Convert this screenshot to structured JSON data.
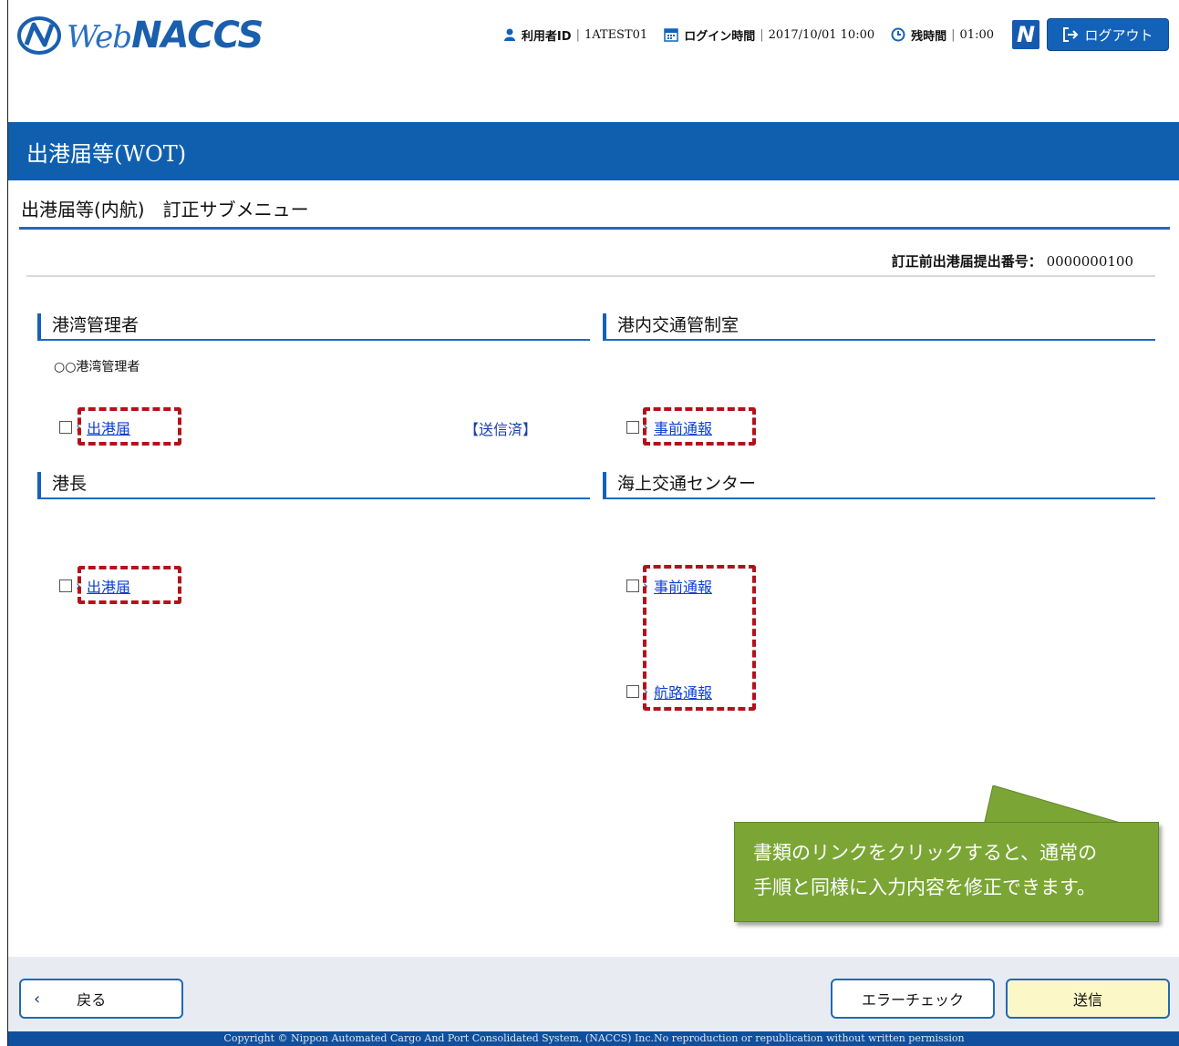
{
  "header": {
    "logo_web": "Web",
    "logo_naccs": "NACCS",
    "user_id_label": "利用者ID",
    "user_id_value": "1ATEST01",
    "login_time_label": "ログイン時間",
    "login_time_value": "2017/10/01 10:00",
    "remaining_label": "残時間",
    "remaining_value": "01:00",
    "n_button": "N",
    "logout_label": "ログアウト"
  },
  "title": "出港届等(WOT)",
  "subtitle": "出港届等(内航)　訂正サブメニュー",
  "correction_number": {
    "label": "訂正前出港届提出番号：",
    "value": "0000000100"
  },
  "sections": {
    "port_manager": {
      "heading": "港湾管理者",
      "note": "○○港湾管理者",
      "link": "出港届",
      "status": "【送信済】"
    },
    "traffic_control": {
      "heading": "港内交通管制室",
      "link": "事前通報"
    },
    "harbor_master": {
      "heading": "港長",
      "link": "出港届"
    },
    "maritime_center": {
      "heading": "海上交通センター",
      "link1": "事前通報",
      "link2": "航路通報"
    }
  },
  "callout": {
    "line1": "書類のリンクをクリックすると、通常の",
    "line2": "手順と同様に入力内容を修正できます。"
  },
  "footer": {
    "back_label": "戻る",
    "error_check_label": "エラーチェック",
    "send_label": "送信",
    "copyright": "Copyright © Nippon Automated Cargo And Port Consolidated System, (NACCS) Inc.No reproduction or republication without written permission"
  },
  "colors": {
    "brand_blue": "#0f5fae",
    "highlight_red": "#b3121b",
    "callout_green": "#7ba636",
    "send_button_bg": "#fbf7c7"
  }
}
